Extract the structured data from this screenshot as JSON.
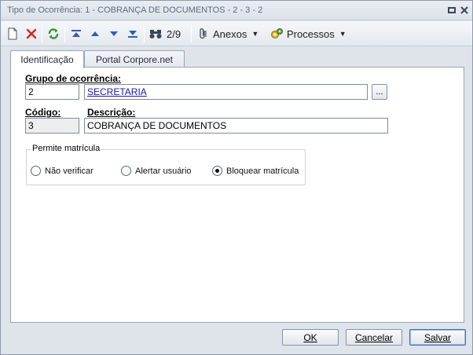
{
  "window": {
    "title": "Tipo de Ocorrência: 1 - COBRANÇA DE DOCUMENTOS - 2 - 3 - 2"
  },
  "toolbar": {
    "record_position": "2/9",
    "attachments_label": "Anexos",
    "processes_label": "Processos"
  },
  "tabs": [
    {
      "label": "Identificação",
      "active": true
    },
    {
      "label": "Portal Corpore.net",
      "active": false
    }
  ],
  "form": {
    "group_label": "Grupo de ocorrência:",
    "group_code": "2",
    "group_name": "SECRETARIA",
    "lookup_button": "...",
    "code_label": "Código:",
    "code_value": "3",
    "description_label": "Descrição:",
    "description_value": "COBRANÇA DE DOCUMENTOS"
  },
  "permite_matricula": {
    "title": "Permite matrícula",
    "options": [
      {
        "label": "Não verificar",
        "selected": false
      },
      {
        "label": "Alertar usuário",
        "selected": false
      },
      {
        "label": "Bloquear matrícula",
        "selected": true
      }
    ]
  },
  "footer": {
    "ok_label": "OK",
    "cancel_label": "Cancelar",
    "save_label": "Salvar"
  },
  "colors": {
    "link": "#1a1aa6",
    "delete_red": "#d9261c",
    "refresh_green": "#2e9a2e",
    "nav_blue": "#2f5fb8"
  }
}
